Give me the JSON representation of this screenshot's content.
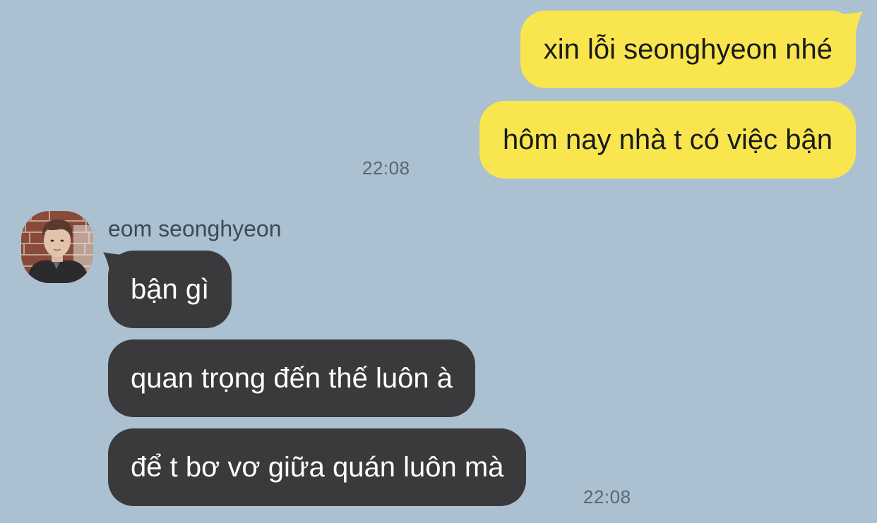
{
  "chat": {
    "outgoing": {
      "messages": [
        {
          "text": "xin lỗi seonghyeon nhé"
        },
        {
          "text": "hôm nay nhà t có việc bận"
        }
      ],
      "time": "22:08"
    },
    "incoming": {
      "sender_name": "eom seonghyeon",
      "avatar_icon": "profile-photo-avatar",
      "messages": [
        {
          "text": "bận gì"
        },
        {
          "text": "quan trọng đến thế luôn à"
        },
        {
          "text": "để t bơ vơ giữa quán luôn mà"
        }
      ],
      "time": "22:08"
    }
  },
  "colors": {
    "background": "#abc1d1",
    "outgoing_bubble": "#f9e64f",
    "incoming_bubble": "#3a3a3d"
  }
}
